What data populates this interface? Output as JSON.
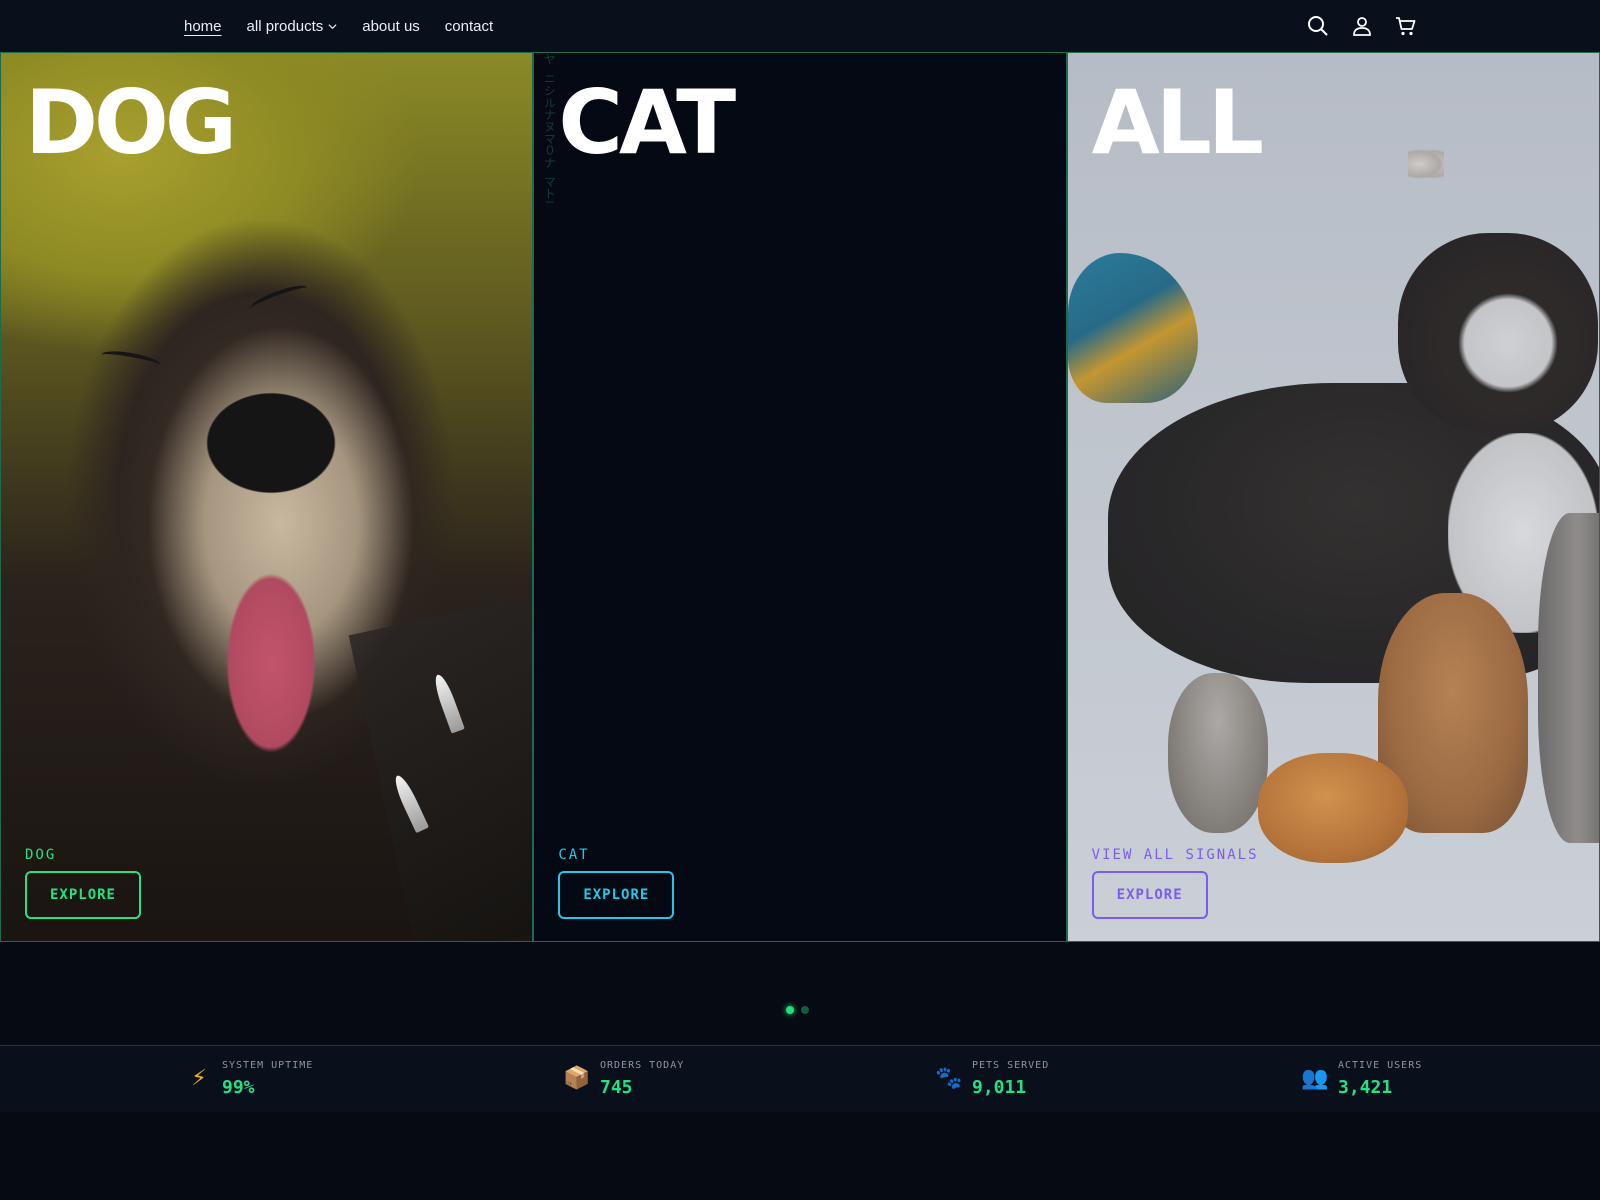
{
  "nav": {
    "links": [
      {
        "label": "home",
        "active": true
      },
      {
        "label": "all products",
        "has_dropdown": true
      },
      {
        "label": "about us"
      },
      {
        "label": "contact"
      }
    ],
    "icons": [
      "search-icon",
      "account-icon",
      "cart-icon"
    ]
  },
  "panels": [
    {
      "title": "DOG",
      "subtitle": "DOG",
      "button": "EXPLORE",
      "accent": "#27e084",
      "image": "smiling-dog-photo"
    },
    {
      "title": "CAT",
      "subtitle": "CAT",
      "button": "EXPLORE",
      "accent": "#25c8e8",
      "image": "matrix-rain-dark"
    },
    {
      "title": "ALL",
      "subtitle": "VIEW ALL SIGNALS",
      "button": "EXPLORE",
      "accent": "#7c5cf0",
      "image": "group-of-pets-photo"
    }
  ],
  "carousel": {
    "active_index": 0,
    "count": 2
  },
  "stats": [
    {
      "icon": "lightning-icon",
      "glyph": "⚡",
      "label": "SYSTEM UPTIME",
      "value": "99%"
    },
    {
      "icon": "package-icon",
      "glyph": "📦",
      "label": "ORDERS TODAY",
      "value": "745"
    },
    {
      "icon": "paw-icon",
      "glyph": "🐾",
      "label": "PETS SERVED",
      "value": "9,011"
    },
    {
      "icon": "users-icon",
      "glyph": "👥",
      "label": "ACTIVE USERS",
      "value": "3,421"
    }
  ],
  "colors": {
    "background": "#060a12",
    "accent_green": "#27e084",
    "accent_cyan": "#25c8e8",
    "accent_purple": "#7c5cf0"
  }
}
